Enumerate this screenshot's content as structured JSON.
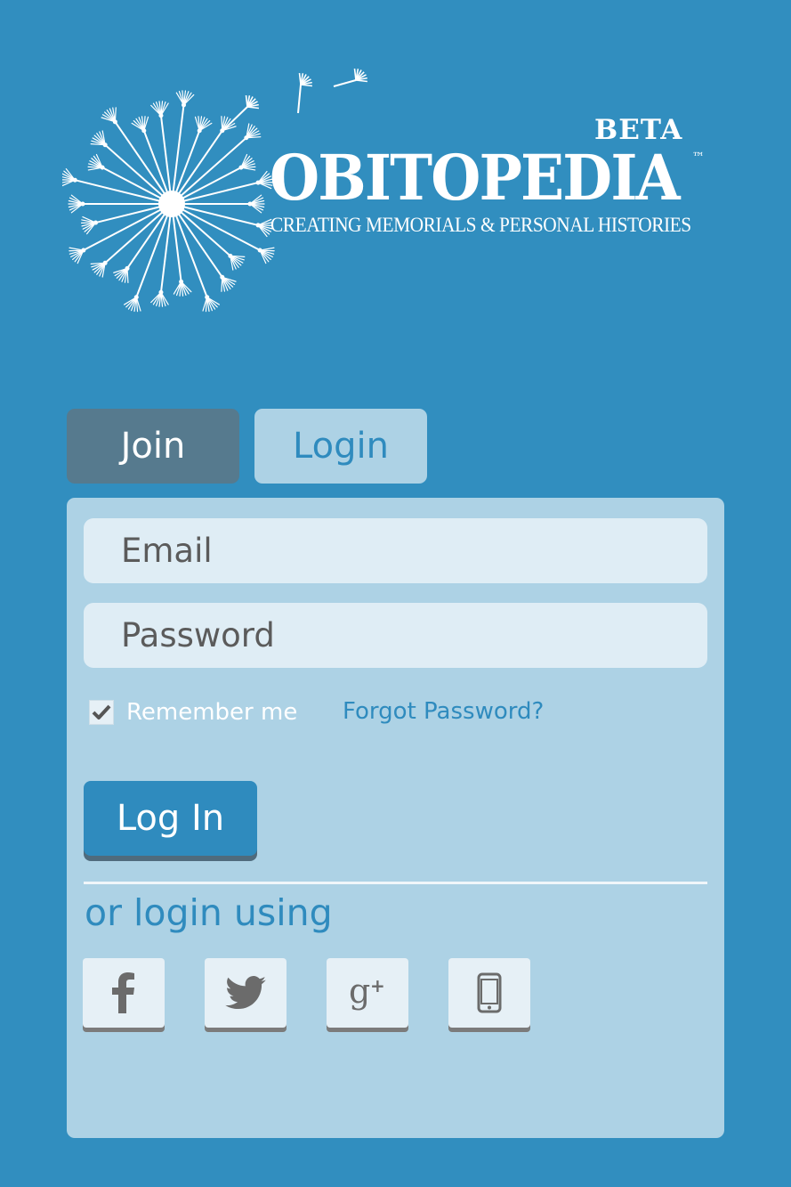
{
  "branding": {
    "beta": "BETA",
    "name": "OBITOPEDIA",
    "trademark": "™",
    "tagline": "CREATING MEMORIALS & PERSONAL HISTORIES"
  },
  "tabs": [
    {
      "label": "Join",
      "active": true
    },
    {
      "label": "Login",
      "active": false
    }
  ],
  "form": {
    "email_placeholder": "Email",
    "email_value": "",
    "password_placeholder": "Password",
    "password_value": "",
    "remember_label": "Remember me",
    "remember_checked": true,
    "forgot_label": "Forgot Password?",
    "submit_label": "Log In",
    "alt_login_label": "or login using"
  },
  "social": [
    {
      "name": "facebook-icon"
    },
    {
      "name": "twitter-icon"
    },
    {
      "name": "google-plus-icon"
    },
    {
      "name": "phone-icon"
    }
  ],
  "colors": {
    "background": "#318ebf",
    "panel": "#add2e5",
    "accent": "#2f8bbe",
    "tab_active": "#567a8e",
    "field": "#dfedf5",
    "icon": "#6b6b6b"
  }
}
